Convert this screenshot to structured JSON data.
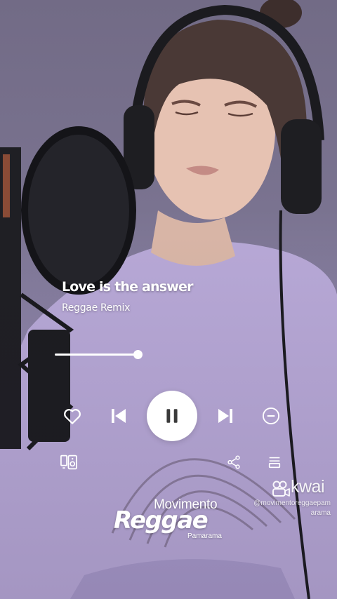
{
  "player": {
    "track_title": "Love is the answer",
    "track_subtitle": "Reggae Remix",
    "progress_fraction": 1.0,
    "icons": {
      "like": "heart-icon",
      "previous": "skip-previous-icon",
      "play_pause": "pause-icon",
      "next": "skip-next-icon",
      "remove": "minus-circle-icon",
      "devices": "devices-speaker-icon",
      "share": "share-icon",
      "queue": "queue-icon"
    }
  },
  "branding": {
    "line1": "Movimento",
    "line2": "Reggae",
    "line3": "Pamarama"
  },
  "watermark": {
    "name": "kwai",
    "handle": "@movimentoreggaepamarama",
    "icon": "kwai-logo-icon"
  },
  "colors": {
    "overlay_text": "#ffffff",
    "pause_button_bg": "#ffffff",
    "pause_glyph": "#3a3a3a"
  }
}
